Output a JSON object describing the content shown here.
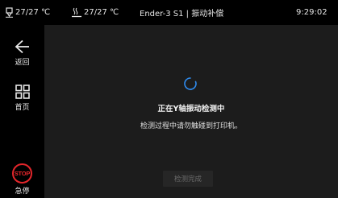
{
  "status": {
    "hotend_temp": "27/27 ℃",
    "bed_temp": "27/27 ℃",
    "title": "Ender-3 S1 | 振动补偿",
    "time": "9:29:02"
  },
  "sidebar": {
    "back_label": "返回",
    "home_label": "首页",
    "stop_icon_text": "STOP",
    "stop_label": "急停"
  },
  "main": {
    "heading": "正在Y轴振动检测中",
    "message": "检测过程中请勿触碰到打印机。",
    "done_button": "检测完成"
  },
  "colors": {
    "accent_blue": "#2f8cf0",
    "stop_red": "#e3262b",
    "panel_bg": "#1c1c1c"
  }
}
